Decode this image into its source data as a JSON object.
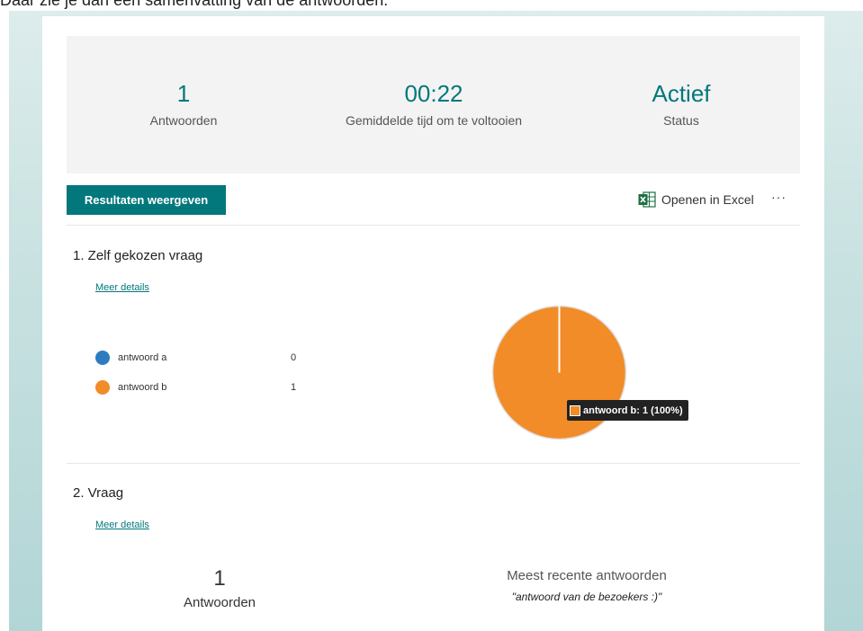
{
  "intro_text": "Daar zie je dan een samenvatting van de antwoorden:",
  "summary": {
    "responses": {
      "value": "1",
      "label": "Antwoorden"
    },
    "avg_time": {
      "value": "00:22",
      "label": "Gemiddelde tijd om te voltooien"
    },
    "status": {
      "value": "Actief",
      "label": "Status"
    }
  },
  "toolbar": {
    "view_results_label": "Resultaten weergeven",
    "open_excel_label": "Openen in Excel",
    "more_label": "···"
  },
  "question1": {
    "title": "1.  Zelf gekozen vraag",
    "details_label": "Meer details",
    "legend": [
      {
        "label": "antwoord a",
        "count": "0",
        "color": "#2e7cc0"
      },
      {
        "label": "antwoord b",
        "count": "1",
        "color": "#f28c28"
      }
    ],
    "tooltip": "antwoord b: 1 (100%)"
  },
  "chart_data": {
    "type": "pie",
    "categories": [
      "antwoord a",
      "antwoord b"
    ],
    "values": [
      0,
      1
    ],
    "colors": [
      "#2e7cc0",
      "#f28c28"
    ]
  },
  "question2": {
    "title": "2.  Vraag",
    "details_label": "Meer details",
    "count_value": "1",
    "count_label": "Antwoorden",
    "recent_title": "Meest recente antwoorden",
    "recent_answer": "\"antwoord van de bezoekers :)\""
  },
  "colors": {
    "accent": "#03787c",
    "excel_green": "#1d6f42"
  }
}
